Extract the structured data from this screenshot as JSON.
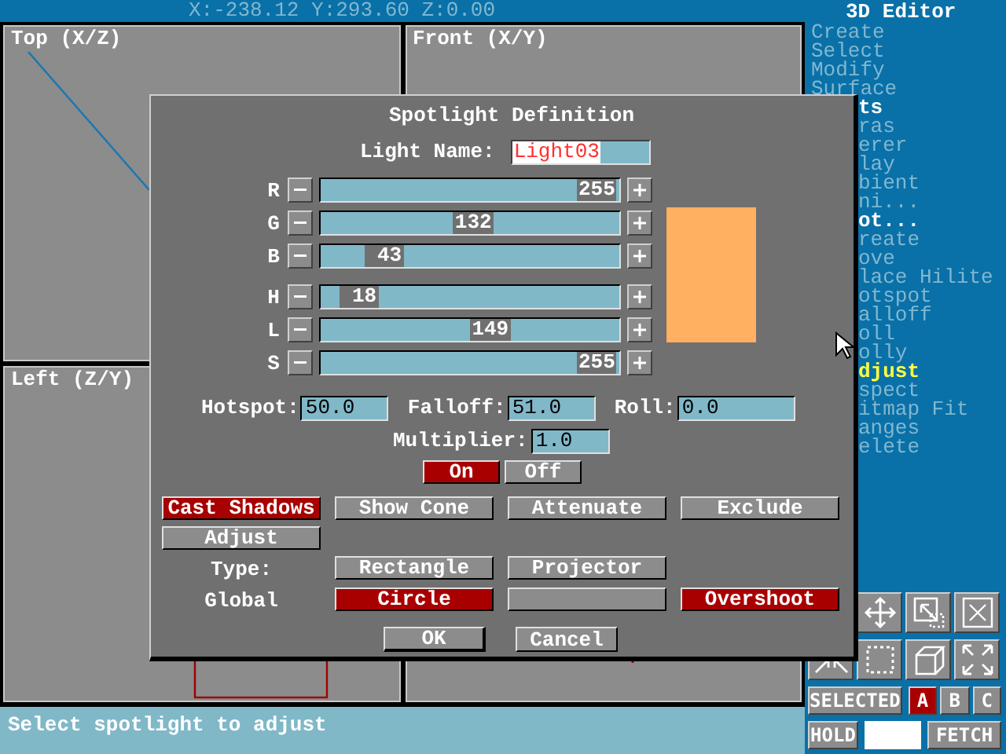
{
  "coordinates": "X:-238.12 Y:293.60  Z:0.00",
  "viewports": [
    {
      "label": "Top (X/Z)"
    },
    {
      "label": "Front (X/Y)"
    },
    {
      "label": "Left (Z/Y)"
    }
  ],
  "status_bar": "Select spotlight to adjust",
  "side_panel": {
    "title": "3D Editor",
    "menu": [
      {
        "label": "Create",
        "expanded": false,
        "selected": false
      },
      {
        "label": "Select",
        "expanded": false,
        "selected": false
      },
      {
        "label": "Modify",
        "expanded": false,
        "selected": false
      },
      {
        "label": "Surface",
        "expanded": false,
        "selected": false
      }
    ],
    "menu_behind_dialog": [
      {
        "label": "ts",
        "expanded": true,
        "selected": false
      },
      {
        "label": "ras",
        "expanded": false,
        "selected": false
      },
      {
        "label": "erer",
        "expanded": false,
        "selected": false
      },
      {
        "label": "lay",
        "expanded": false,
        "selected": false
      },
      {
        "label": "bient",
        "expanded": false,
        "selected": false
      },
      {
        "label": "ni...",
        "expanded": false,
        "selected": false
      },
      {
        "label": "ot...",
        "expanded": true,
        "selected": false
      },
      {
        "label": "reate",
        "expanded": false,
        "selected": false
      },
      {
        "label": "ove",
        "expanded": false,
        "selected": false
      },
      {
        "label": "lace Hilite",
        "expanded": false,
        "selected": false
      },
      {
        "label": "otspot",
        "expanded": false,
        "selected": false
      },
      {
        "label": "alloff",
        "expanded": false,
        "selected": false
      },
      {
        "label": "oll",
        "expanded": false,
        "selected": false
      },
      {
        "label": "olly",
        "expanded": false,
        "selected": false
      },
      {
        "label": "djust",
        "expanded": false,
        "selected": true
      },
      {
        "label": "spect",
        "expanded": false,
        "selected": false
      },
      {
        "label": "itmap Fit",
        "expanded": false,
        "selected": false
      },
      {
        "label": "anges",
        "expanded": false,
        "selected": false
      },
      {
        "label": "elete",
        "expanded": false,
        "selected": false
      }
    ],
    "selection_buttons": [
      {
        "label": "SELECTED",
        "selected": false
      },
      {
        "label": "A",
        "selected": true
      },
      {
        "label": "B",
        "selected": false
      },
      {
        "label": "C",
        "selected": false
      }
    ],
    "hold_button": "HOLD",
    "fetch_button": "FETCH"
  },
  "dialog": {
    "title": "Spotlight Definition",
    "light_name_label": "Light Name:",
    "light_name": "Light03",
    "slider_groups": [
      [
        {
          "label": "R",
          "value": "255",
          "level": 1.0
        },
        {
          "label": "G",
          "value": "132",
          "level": 0.518
        },
        {
          "label": "B",
          "value": "43",
          "level": 0.169
        }
      ],
      [
        {
          "label": "H",
          "value": "18",
          "level": 0.071
        },
        {
          "label": "L",
          "value": "149",
          "level": 0.584
        },
        {
          "label": "S",
          "value": "255",
          "level": 1.0
        }
      ]
    ],
    "angle_fields": [
      {
        "label": "Hotspot:",
        "value": "50.0"
      },
      {
        "label": "Falloff:",
        "value": "51.0"
      },
      {
        "label": "Roll:",
        "value": "0.0"
      }
    ],
    "multiplier": {
      "label": "Multiplier:",
      "value": "1.0"
    },
    "power": [
      {
        "label": "On",
        "selected": true
      },
      {
        "label": "Off",
        "selected": false
      }
    ],
    "options": [
      {
        "kind": "button",
        "label": "Cast Shadows",
        "selected": true
      },
      {
        "kind": "button",
        "label": "Show Cone",
        "selected": false
      },
      {
        "kind": "button",
        "label": "Attenuate",
        "selected": false
      },
      {
        "kind": "button",
        "label": "Exclude",
        "selected": false
      },
      {
        "kind": "button",
        "label": "Adjust",
        "selected": false
      },
      {
        "kind": "text",
        "label": "Type:"
      },
      {
        "kind": "button",
        "label": "Rectangle",
        "selected": false
      },
      {
        "kind": "button",
        "label": "Projector",
        "selected": false
      },
      {
        "kind": "text",
        "label": "Global"
      },
      {
        "kind": "button",
        "label": "Circle",
        "selected": true
      },
      {
        "kind": "button",
        "selected": false
      },
      {
        "kind": "button",
        "label": "Overshoot",
        "selected": true
      }
    ],
    "actions": [
      "OK",
      "Cancel"
    ]
  }
}
